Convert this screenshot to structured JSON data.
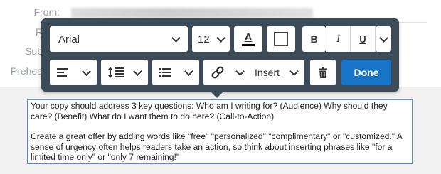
{
  "header_fields": {
    "from_label": "From:",
    "reply_label": "R",
    "subject_label": "Sub",
    "preheader_label": "Prehea"
  },
  "toolbar": {
    "font_family": "Arial",
    "font_size": "12",
    "text_color_icon": "A",
    "bold": "B",
    "italic": "I",
    "underline": "U",
    "insert_label": "Insert",
    "done_label": "Done"
  },
  "editor": {
    "paragraph1": "Your copy should address 3 key questions: Who am I writing for? (Audience) Why should they care? (Benefit) What do I want them to do here? (Call-to-Action)",
    "paragraph2": "Create a great offer by adding words like \"free\" \"personalized\" \"complimentary\" or \"customized.\" A sense of urgency often helps readers take an action, so think about inserting phrases like \"for a limited time only\" or \"only 7 remaining!\""
  },
  "colors": {
    "toolbar_bg": "#3d4a58",
    "done_bg": "#1874c7",
    "editor_border": "#4a90e2"
  }
}
